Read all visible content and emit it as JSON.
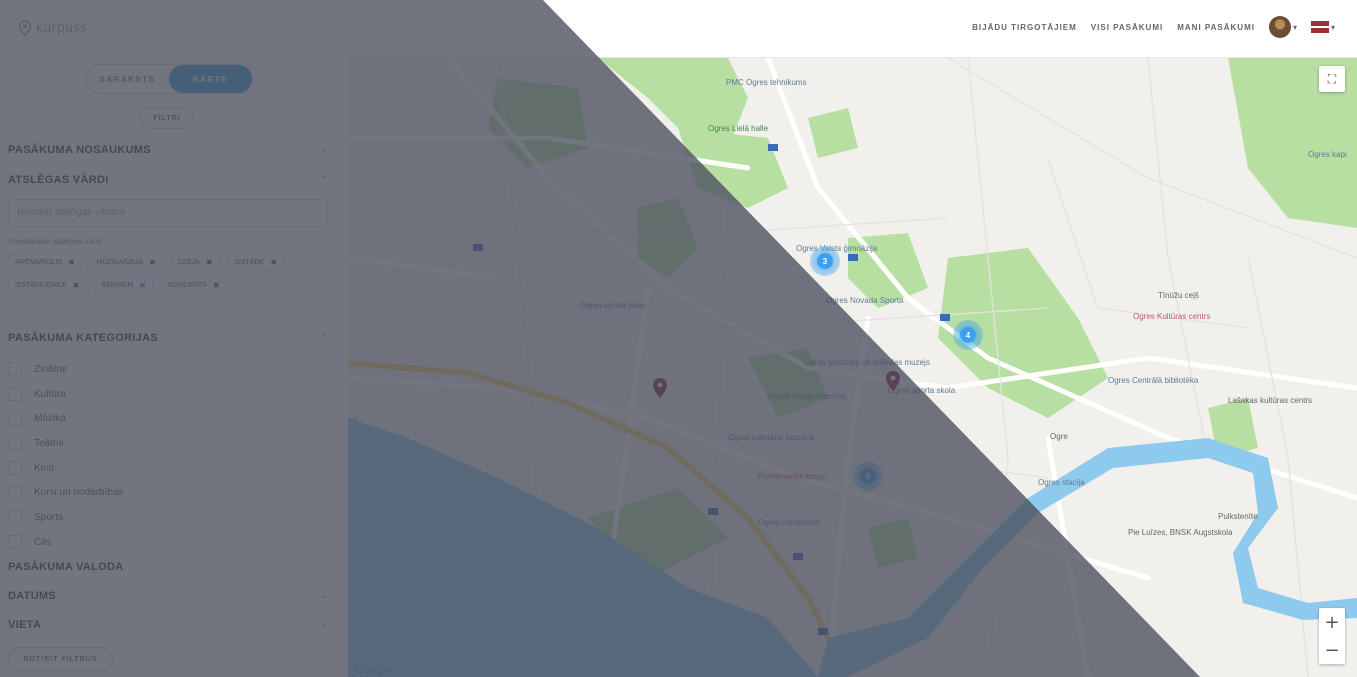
{
  "header": {
    "logo_text": "kurpuss",
    "nav": [
      "BIJĀDU TIRGOTĀJIEM",
      "VISI PASĀKUMI",
      "MANI PASĀKUMI"
    ]
  },
  "sidebar": {
    "view_toggle": {
      "list": "SARAKSTS",
      "map": "KARTE",
      "active": "map"
    },
    "filter_button": "FILTRI",
    "sections": {
      "name": "PASĀKUMA NOSAUKUMS",
      "keywords": "ATSLĒGAS VĀRDI",
      "categories": "PASĀKUMA KATEGORIJAS",
      "language": "PASĀKUMA VALODA",
      "date": "DATUMS",
      "place": "VIETA"
    },
    "keywords_placeholder": "Ievadiet atslēgas vārdus",
    "popular_label": "Populārākie atslēgas vārdi",
    "tags": [
      "ARĒNA/ROLIS",
      "MŪZIKA/DEJA",
      "DZEJA",
      "IZSTĀDE",
      "IZSTĀDE/DAILE",
      "BĒRNIEM",
      "KONCERTS"
    ],
    "categories": [
      "Zinātne",
      "Kultūra",
      "Mūzika",
      "Teātris",
      "Kino",
      "Kursi un nodarbības",
      "Sports",
      "Cits"
    ],
    "show_button": "NOTĪRĪT FILTRUS"
  },
  "map": {
    "clusters": [
      {
        "label": "3"
      },
      {
        "label": "4"
      },
      {
        "label": "5"
      }
    ],
    "pois": [
      "PMC Ogres tehnikums",
      "Ogres Lielā halle",
      "Ogres Valsts ģimnāzija",
      "Ogres Novada Sporta",
      "Ogres Centrālā bibliotēka",
      "Ogres Vēstures un mākslas muzejs",
      "Ogres Kultūras centrs",
      "Ogres sporta skola",
      "Ogres Katoļu baznīca",
      "Ogres Luterāņu baznīca",
      "Ogres kapi",
      "Ogres vidusskola",
      "Pie Luīzes, BNSK Augstskola",
      "Pulkstenīte",
      "Tīnūžu ceļš",
      "Lašakas kultūras centrs",
      "Ogres stacija",
      "Promenādes krogs",
      "Ogres sporta halle",
      "Ogre"
    ],
    "brand": "Google",
    "fullscreen_label": "⛶",
    "zoom_in": "+",
    "zoom_out": "−"
  },
  "colors": {
    "accent": "#3399dd",
    "overlay": "#4a4e5c",
    "park": "#b8dfa2",
    "river": "#8ec9ee",
    "pin": "#8a1c3c"
  }
}
